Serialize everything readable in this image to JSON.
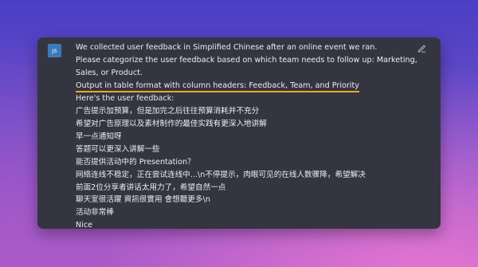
{
  "avatar": {
    "initials": "JS"
  },
  "message": {
    "lines": [
      "We collected user feedback in Simplified Chinese after an online event we ran.",
      "Please categorize the user feedback based on which team needs to follow up: Marketing,",
      "Sales, or Product.",
      "Output in table format with column headers: Feedback, Team, and Priority",
      "Here's the user feedback:",
      "广告提示加预算，但是加完之后往往预算消耗并不充分",
      "希望对广告原理以及素材制作的最佳实践有更深入地讲解",
      "早一点通知呀",
      "答题可以更深入讲解一些",
      "能否提供活动中的 Presentation？",
      "网络连线不稳定，正在尝试连线中...\\n不停提示，肉眼可见的在线人数骤降，希望解决",
      "前面2位分享者讲话太用力了，希望自然一点",
      "聊天室很活躍 資訊很實用 會想聽更多\\n",
      "活动非常棒",
      "Nice"
    ]
  },
  "colors": {
    "card_background": "#343541",
    "text": "#ececf1",
    "avatar_background": "#3e7ab8",
    "highlight_underline": "#f5a623"
  },
  "icons": {
    "edit": "pencil-edit-icon"
  }
}
